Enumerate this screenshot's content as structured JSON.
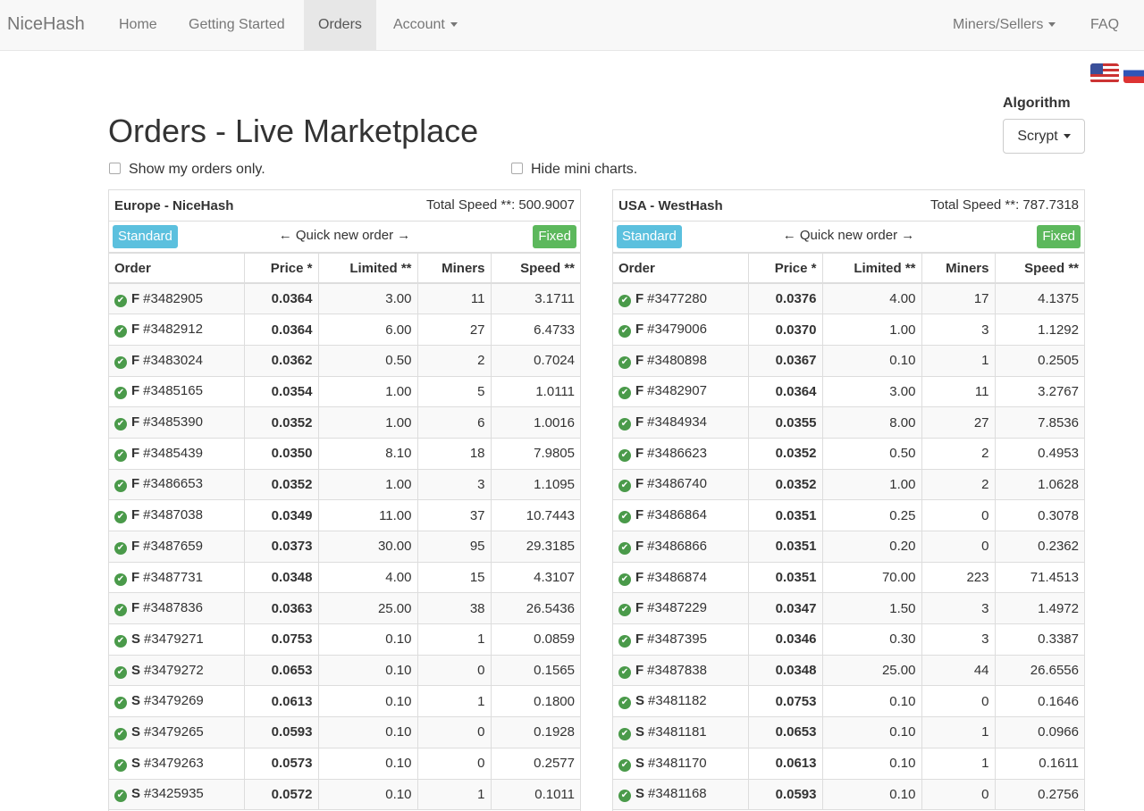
{
  "nav": {
    "brand": "NiceHash",
    "home": "Home",
    "getting_started": "Getting Started",
    "orders": "Orders",
    "account": "Account",
    "miners": "Miners/Sellers",
    "faq": "FAQ"
  },
  "algorithm": {
    "label": "Algorithm",
    "value": "Scrypt"
  },
  "page_title": "Orders - Live Marketplace",
  "options": {
    "show_mine": "Show my orders only.",
    "hide_charts": "Hide mini charts."
  },
  "columns": [
    "Order",
    "Price *",
    "Limited **",
    "Miners",
    "Speed **"
  ],
  "panel_labels": {
    "standard": "Standard",
    "fixed": "Fixed",
    "quick": "Quick new order"
  },
  "panels": [
    {
      "title": "Europe - NiceHash",
      "total_speed": "Total Speed **: 500.9007",
      "rows": [
        {
          "type": "F",
          "id": "#3482905",
          "price": "0.0364",
          "limited": "3.00",
          "miners": "11",
          "speed": "3.1711"
        },
        {
          "type": "F",
          "id": "#3482912",
          "price": "0.0364",
          "limited": "6.00",
          "miners": "27",
          "speed": "6.4733"
        },
        {
          "type": "F",
          "id": "#3483024",
          "price": "0.0362",
          "limited": "0.50",
          "miners": "2",
          "speed": "0.7024"
        },
        {
          "type": "F",
          "id": "#3485165",
          "price": "0.0354",
          "limited": "1.00",
          "miners": "5",
          "speed": "1.0111"
        },
        {
          "type": "F",
          "id": "#3485390",
          "price": "0.0352",
          "limited": "1.00",
          "miners": "6",
          "speed": "1.0016"
        },
        {
          "type": "F",
          "id": "#3485439",
          "price": "0.0350",
          "limited": "8.10",
          "miners": "18",
          "speed": "7.9805"
        },
        {
          "type": "F",
          "id": "#3486653",
          "price": "0.0352",
          "limited": "1.00",
          "miners": "3",
          "speed": "1.1095"
        },
        {
          "type": "F",
          "id": "#3487038",
          "price": "0.0349",
          "limited": "11.00",
          "miners": "37",
          "speed": "10.7443"
        },
        {
          "type": "F",
          "id": "#3487659",
          "price": "0.0373",
          "limited": "30.00",
          "miners": "95",
          "speed": "29.3185"
        },
        {
          "type": "F",
          "id": "#3487731",
          "price": "0.0348",
          "limited": "4.00",
          "miners": "15",
          "speed": "4.3107"
        },
        {
          "type": "F",
          "id": "#3487836",
          "price": "0.0363",
          "limited": "25.00",
          "miners": "38",
          "speed": "26.5436"
        },
        {
          "type": "S",
          "id": "#3479271",
          "price": "0.0753",
          "limited": "0.10",
          "miners": "1",
          "speed": "0.0859"
        },
        {
          "type": "S",
          "id": "#3479272",
          "price": "0.0653",
          "limited": "0.10",
          "miners": "0",
          "speed": "0.1565"
        },
        {
          "type": "S",
          "id": "#3479269",
          "price": "0.0613",
          "limited": "0.10",
          "miners": "1",
          "speed": "0.1800"
        },
        {
          "type": "S",
          "id": "#3479265",
          "price": "0.0593",
          "limited": "0.10",
          "miners": "0",
          "speed": "0.1928"
        },
        {
          "type": "S",
          "id": "#3479263",
          "price": "0.0573",
          "limited": "0.10",
          "miners": "0",
          "speed": "0.2577"
        },
        {
          "type": "S",
          "id": "#3425935",
          "price": "0.0572",
          "limited": "0.10",
          "miners": "1",
          "speed": "0.1011"
        }
      ]
    },
    {
      "title": "USA - WestHash",
      "total_speed": "Total Speed **: 787.7318",
      "rows": [
        {
          "type": "F",
          "id": "#3477280",
          "price": "0.0376",
          "limited": "4.00",
          "miners": "17",
          "speed": "4.1375"
        },
        {
          "type": "F",
          "id": "#3479006",
          "price": "0.0370",
          "limited": "1.00",
          "miners": "3",
          "speed": "1.1292"
        },
        {
          "type": "F",
          "id": "#3480898",
          "price": "0.0367",
          "limited": "0.10",
          "miners": "1",
          "speed": "0.2505"
        },
        {
          "type": "F",
          "id": "#3482907",
          "price": "0.0364",
          "limited": "3.00",
          "miners": "11",
          "speed": "3.2767"
        },
        {
          "type": "F",
          "id": "#3484934",
          "price": "0.0355",
          "limited": "8.00",
          "miners": "27",
          "speed": "7.8536"
        },
        {
          "type": "F",
          "id": "#3486623",
          "price": "0.0352",
          "limited": "0.50",
          "miners": "2",
          "speed": "0.4953"
        },
        {
          "type": "F",
          "id": "#3486740",
          "price": "0.0352",
          "limited": "1.00",
          "miners": "2",
          "speed": "1.0628"
        },
        {
          "type": "F",
          "id": "#3486864",
          "price": "0.0351",
          "limited": "0.25",
          "miners": "0",
          "speed": "0.3078"
        },
        {
          "type": "F",
          "id": "#3486866",
          "price": "0.0351",
          "limited": "0.20",
          "miners": "0",
          "speed": "0.2362"
        },
        {
          "type": "F",
          "id": "#3486874",
          "price": "0.0351",
          "limited": "70.00",
          "miners": "223",
          "speed": "71.4513"
        },
        {
          "type": "F",
          "id": "#3487229",
          "price": "0.0347",
          "limited": "1.50",
          "miners": "3",
          "speed": "1.4972"
        },
        {
          "type": "F",
          "id": "#3487395",
          "price": "0.0346",
          "limited": "0.30",
          "miners": "3",
          "speed": "0.3387"
        },
        {
          "type": "F",
          "id": "#3487838",
          "price": "0.0348",
          "limited": "25.00",
          "miners": "44",
          "speed": "26.6556"
        },
        {
          "type": "S",
          "id": "#3481182",
          "price": "0.0753",
          "limited": "0.10",
          "miners": "0",
          "speed": "0.1646"
        },
        {
          "type": "S",
          "id": "#3481181",
          "price": "0.0653",
          "limited": "0.10",
          "miners": "1",
          "speed": "0.0966"
        },
        {
          "type": "S",
          "id": "#3481170",
          "price": "0.0613",
          "limited": "0.10",
          "miners": "1",
          "speed": "0.1611"
        },
        {
          "type": "S",
          "id": "#3481168",
          "price": "0.0593",
          "limited": "0.10",
          "miners": "0",
          "speed": "0.2756"
        }
      ]
    }
  ]
}
